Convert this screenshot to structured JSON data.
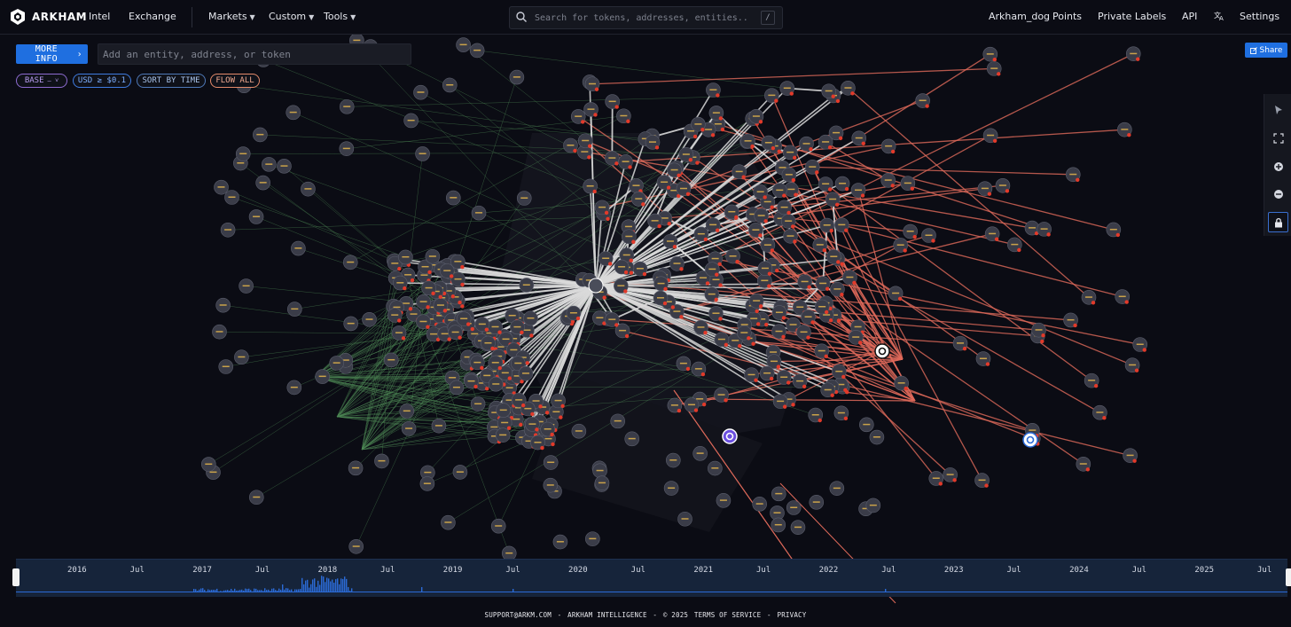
{
  "app": {
    "brand": "ARKHAM"
  },
  "nav": {
    "left": [
      "Intel",
      "Exchange"
    ],
    "menus": [
      "Markets",
      "Custom",
      "Tools"
    ],
    "right": [
      "Arkham_dog",
      "Points",
      "Private Labels",
      "API",
      "Settings"
    ]
  },
  "search": {
    "placeholder": "Search for tokens, addresses, entities...",
    "shortcut": "/"
  },
  "toolbar": {
    "more_info_label": "MORE INFO",
    "entity_placeholder": "Add an entity, address, or token",
    "filters": {
      "base": "BASE",
      "usd": "USD ≥ $0.1",
      "sort": "SORT BY TIME",
      "flow": "FLOW ALL"
    },
    "share_label": "Share"
  },
  "side_tools": [
    "cursor-icon",
    "fit-screen-icon",
    "zoom-in-icon",
    "zoom-out-icon",
    "lock-icon"
  ],
  "timeline": {
    "labels": [
      "2016",
      "Jul",
      "2017",
      "Jul",
      "2018",
      "Jul",
      "2019",
      "Jul",
      "2020",
      "Jul",
      "2021",
      "Jul",
      "2022",
      "Jul",
      "2023",
      "Jul",
      "2024",
      "Jul",
      "2025",
      "Jul"
    ]
  },
  "footer": {
    "email": "SUPPORT@ARKM.COM",
    "company": "ARKHAM INTELLIGENCE",
    "copyright": "© 2025",
    "terms": "TERMS OF SERVICE",
    "privacy": "PRIVACY",
    "separator": "-"
  },
  "colors": {
    "background": "#0b0c14",
    "accent": "#1f6fe0",
    "edge_white": "#d9d9d9",
    "edge_green": "#4f8a55",
    "edge_red": "#e06a5a",
    "node_fill": "#3a3c48",
    "node_dot": "#e23a2a"
  }
}
